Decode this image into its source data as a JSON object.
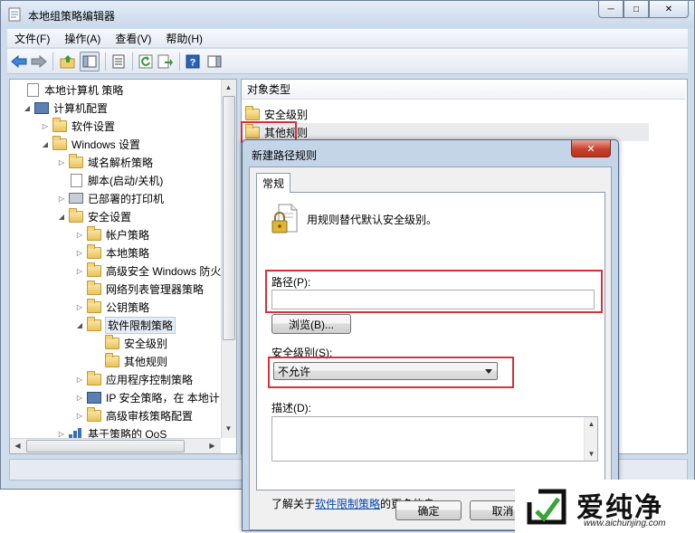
{
  "window": {
    "title": "本地组策略编辑器",
    "controls": {
      "minimize": "─",
      "maximize": "□",
      "close": "✕"
    }
  },
  "menu": [
    "文件(F)",
    "操作(A)",
    "查看(V)",
    "帮助(H)"
  ],
  "toolbar": {
    "icons": [
      "back-icon",
      "forward-icon",
      "up-folder-icon",
      "show-hide-tree-icon",
      "properties-icon",
      "refresh-icon",
      "export-list-icon",
      "help-icon",
      "show-action-pane-icon"
    ]
  },
  "tree": {
    "items": [
      {
        "label": "本地计算机 策略",
        "arrow": "",
        "icon": "doc"
      },
      {
        "label": "计算机配置",
        "arrow": "◢",
        "icon": "pc"
      },
      {
        "label": "软件设置",
        "arrow": "▷",
        "icon": "folder"
      },
      {
        "label": "Windows 设置",
        "arrow": "◢",
        "icon": "folder"
      },
      {
        "label": "域名解析策略",
        "arrow": "▷",
        "icon": "folder"
      },
      {
        "label": "脚本(启动/关机)",
        "arrow": "",
        "icon": "doc"
      },
      {
        "label": "已部署的打印机",
        "arrow": "▷",
        "icon": "printer"
      },
      {
        "label": "安全设置",
        "arrow": "◢",
        "icon": "folder"
      },
      {
        "label": "帐户策略",
        "arrow": "▷",
        "icon": "folder"
      },
      {
        "label": "本地策略",
        "arrow": "▷",
        "icon": "folder"
      },
      {
        "label": "高级安全 Windows 防火",
        "arrow": "▷",
        "icon": "folder"
      },
      {
        "label": "网络列表管理器策略",
        "arrow": "",
        "icon": "folder"
      },
      {
        "label": "公钥策略",
        "arrow": "▷",
        "icon": "folder"
      },
      {
        "label": "软件限制策略",
        "arrow": "◢",
        "icon": "folder"
      },
      {
        "label": "安全级别",
        "arrow": "",
        "icon": "folder"
      },
      {
        "label": "其他规则",
        "arrow": "",
        "icon": "folder"
      },
      {
        "label": "应用程序控制策略",
        "arrow": "▷",
        "icon": "folder"
      },
      {
        "label": "IP 安全策略，在 本地计",
        "arrow": "▷",
        "icon": "pc"
      },
      {
        "label": "高级审核策略配置",
        "arrow": "▷",
        "icon": "folder"
      },
      {
        "label": "基于策略的 QoS",
        "arrow": "▷",
        "icon": "chart"
      }
    ]
  },
  "list": {
    "column": "对象类型",
    "rows": [
      "安全级别",
      "其他规则"
    ],
    "selected": "其他规则"
  },
  "dialog": {
    "title": "新建路径规则",
    "close": "✕",
    "tab": "常规",
    "intro": "用规则替代默认安全级别。",
    "path_label": "路径(P):",
    "path_value": "",
    "browse": "浏览(B)...",
    "security_label": "安全级别(S):",
    "security_value": "不允许",
    "desc_label": "描述(D):",
    "desc_value": "",
    "footer_prefix": "了解关于",
    "footer_link": "软件限制策略",
    "footer_suffix": "的更多信息",
    "ok": "确定",
    "cancel": "取消"
  },
  "watermark": {
    "text": "爱纯净",
    "url": "www.aichunjing.com"
  },
  "colors": {
    "highlight": "#d8313a",
    "link": "#0645ad",
    "folder": "#e9c25a",
    "window_frame": "#cfdcec"
  }
}
